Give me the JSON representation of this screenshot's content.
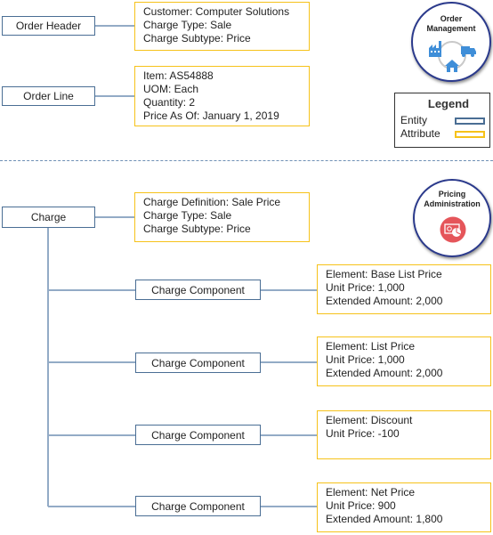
{
  "order_section": {
    "order_header": {
      "label": "Order Header",
      "attributes": [
        "Customer: Computer Solutions",
        "Charge Type: Sale",
        "Charge Subtype: Price"
      ]
    },
    "order_line": {
      "label": "Order Line",
      "attributes": [
        "Item: AS54888",
        "UOM: Each",
        "Quantity: 2",
        "Price As Of: January 1, 2019"
      ]
    },
    "badge": {
      "line1": "Order",
      "line2": "Management"
    }
  },
  "legend": {
    "title": "Legend",
    "items": [
      {
        "label": "Entity",
        "color": "#4a6e94"
      },
      {
        "label": "Attribute",
        "color": "#f6c21a"
      }
    ]
  },
  "pricing_section": {
    "charge": {
      "label": "Charge",
      "attributes": [
        "Charge Definition: Sale Price",
        "Charge Type: Sale",
        "Charge Subtype: Price"
      ]
    },
    "badge": {
      "line1": "Pricing",
      "line2": "Administration"
    },
    "components": [
      {
        "label": "Charge Component",
        "attributes": [
          "Element: Base List Price",
          "Unit Price: 1,000",
          "Extended Amount: 2,000"
        ]
      },
      {
        "label": "Charge Component",
        "attributes": [
          "Element: List Price",
          "Unit Price: 1,000",
          "Extended Amount: 2,000"
        ]
      },
      {
        "label": "Charge Component",
        "attributes": [
          "Element: Discount",
          "Unit Price: -100"
        ]
      },
      {
        "label": "Charge Component",
        "attributes": [
          "Element: Net Price",
          "Unit Price: 900",
          "Extended Amount: 1,800"
        ]
      }
    ]
  },
  "colors": {
    "entity_border": "#4a6e94",
    "attribute_border": "#f6c21a",
    "connector": "#93abc6",
    "order_icon": "#3f8ed8",
    "pricing_icon_bg": "#e5555a"
  }
}
